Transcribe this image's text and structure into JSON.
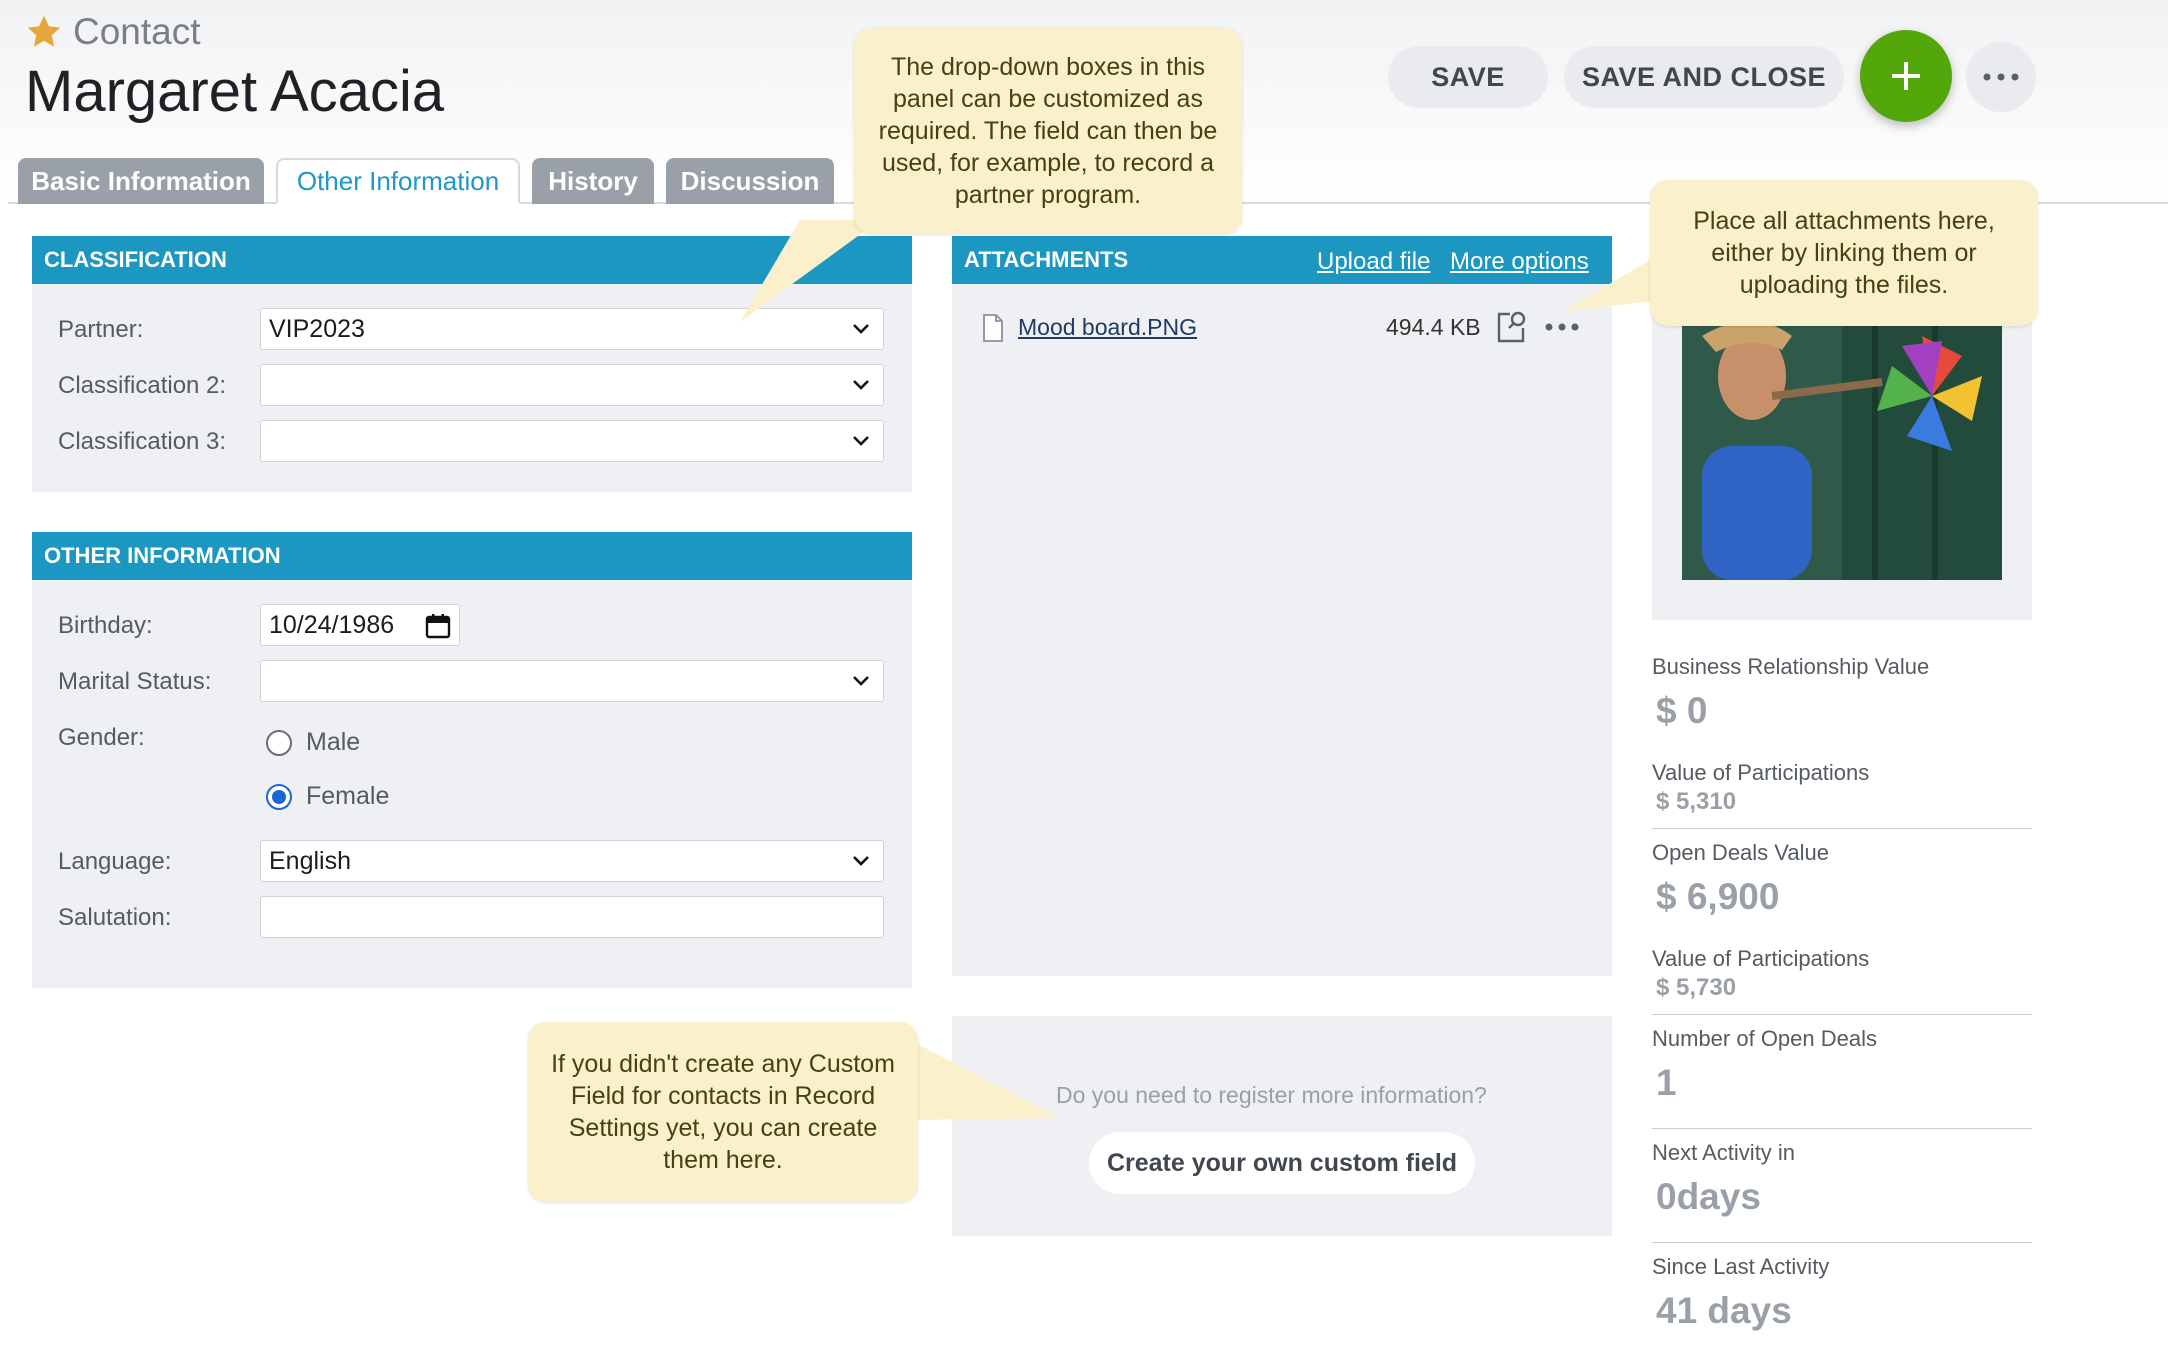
{
  "header": {
    "record_type": "Contact",
    "name": "Margaret Acacia"
  },
  "toolbar": {
    "save_label": "SAVE",
    "save_close_label": "SAVE AND CLOSE",
    "add_label": "+"
  },
  "tabs": [
    {
      "label": "Basic Information",
      "active": false
    },
    {
      "label": "Other Information",
      "active": true
    },
    {
      "label": "History",
      "active": false
    },
    {
      "label": "Discussion",
      "active": false
    }
  ],
  "classification": {
    "title": "CLASSIFICATION",
    "partner_label": "Partner:",
    "partner_value": "VIP2023",
    "class2_label": "Classification 2:",
    "class2_value": "",
    "class3_label": "Classification 3:",
    "class3_value": ""
  },
  "other_info": {
    "title": "OTHER INFORMATION",
    "birthday_label": "Birthday:",
    "birthday_value": "10/24/1986",
    "marital_label": "Marital Status:",
    "marital_value": "",
    "gender_label": "Gender:",
    "gender_options": [
      "Male",
      "Female"
    ],
    "gender_selected": "Female",
    "language_label": "Language:",
    "language_value": "English",
    "salutation_label": "Salutation:",
    "salutation_value": ""
  },
  "attachments": {
    "title": "ATTACHMENTS",
    "upload_label": "Upload file",
    "more_options_label": "More options",
    "files": [
      {
        "name": "Mood board.PNG",
        "size": "494.4 KB"
      }
    ]
  },
  "custom_field": {
    "question": "Do you need to register more information?",
    "button_label": "Create your own custom field"
  },
  "stats": {
    "business_relationship_label": "Business Relationship Value",
    "business_relationship_value": "$ 0",
    "participations1_label": "Value of Participations",
    "participations1_value": "$ 5,310",
    "open_deals_value_label": "Open Deals Value",
    "open_deals_value": "$ 6,900",
    "participations2_label": "Value of Participations",
    "participations2_value": "$ 5,730",
    "open_deals_count_label": "Number of Open Deals",
    "open_deals_count": "1",
    "next_activity_label": "Next Activity in",
    "next_activity_value": "0days",
    "last_activity_label": "Since Last Activity",
    "last_activity_value": "41 days"
  },
  "callouts": {
    "dropdowns": "The drop-down boxes in this panel can be customized as required. The field can then be used, for example, to record a partner program.",
    "attachments": "Place all attachments here, either by linking them or uploading the files.",
    "custom_field": "If you didn't create any Custom Field for contacts in Record Settings yet, you can create them here."
  },
  "colors": {
    "accent": "#1b97c1",
    "add_button": "#53a70b",
    "callout_bg": "#faf0cb",
    "star": "#e8a73a"
  }
}
